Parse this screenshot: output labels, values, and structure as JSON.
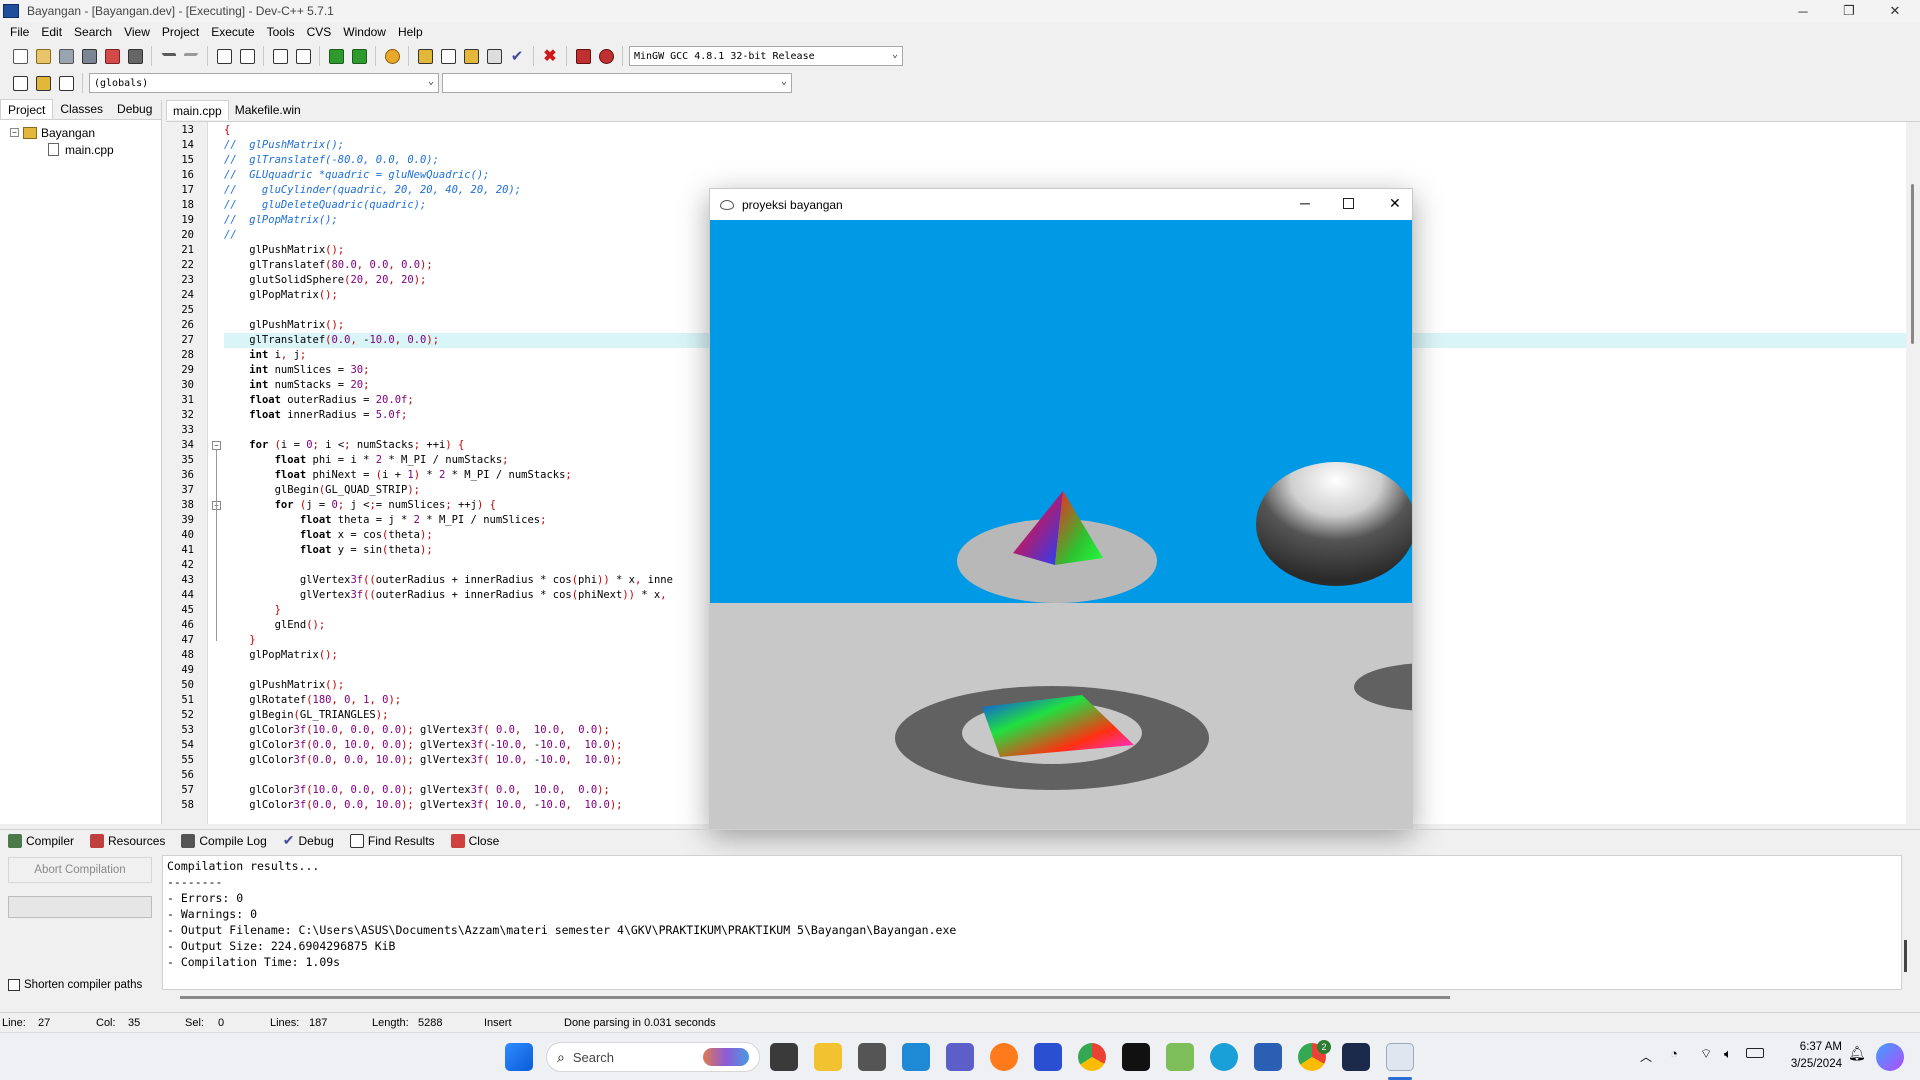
{
  "window": {
    "title": "Bayangan - [Bayangan.dev] - [Executing] - Dev-C++ 5.7.1",
    "minimize": "─",
    "restore": "❐",
    "close": "✕"
  },
  "menu": [
    "File",
    "Edit",
    "Search",
    "View",
    "Project",
    "Execute",
    "Tools",
    "CVS",
    "Window",
    "Help"
  ],
  "toolbar": {
    "compiler_select": "MinGW GCC 4.8.1 32-bit Release",
    "scope_select": "(globals)",
    "function_select": ""
  },
  "left_panel": {
    "tabs": [
      "Project",
      "Classes",
      "Debug"
    ],
    "active_tab": "Project",
    "tree": {
      "project": "Bayangan",
      "file": "main.cpp"
    }
  },
  "editor": {
    "tabs": [
      "main.cpp",
      "Makefile.win"
    ],
    "active_tab": "main.cpp",
    "highlighted_line": 27,
    "lines": [
      {
        "n": "13",
        "t": "{"
      },
      {
        "n": "14",
        "t": "//  glPushMatrix();"
      },
      {
        "n": "15",
        "t": "//  glTranslatef(-80.0, 0.0, 0.0);"
      },
      {
        "n": "16",
        "t": "//  GLUquadric *quadric = gluNewQuadric();"
      },
      {
        "n": "17",
        "t": "//    gluCylinder(quadric, 20, 20, 40, 20, 20);"
      },
      {
        "n": "18",
        "t": "//    gluDeleteQuadric(quadric);"
      },
      {
        "n": "19",
        "t": "//  glPopMatrix();"
      },
      {
        "n": "20",
        "t": "//"
      },
      {
        "n": "21",
        "t": "    glPushMatrix();"
      },
      {
        "n": "22",
        "t": "    glTranslatef(80.0, 0.0, 0.0);"
      },
      {
        "n": "23",
        "t": "    glutSolidSphere(20, 20, 20);"
      },
      {
        "n": "24",
        "t": "    glPopMatrix();"
      },
      {
        "n": "25",
        "t": ""
      },
      {
        "n": "26",
        "t": "    glPushMatrix();"
      },
      {
        "n": "27",
        "t": "    glTranslatef(0.0, -10.0, 0.0);"
      },
      {
        "n": "28",
        "t": "    int i, j;"
      },
      {
        "n": "29",
        "t": "    int numSlices = 30;"
      },
      {
        "n": "30",
        "t": "    int numStacks = 20;"
      },
      {
        "n": "31",
        "t": "    float outerRadius = 20.0f;"
      },
      {
        "n": "32",
        "t": "    float innerRadius = 5.0f;"
      },
      {
        "n": "33",
        "t": ""
      },
      {
        "n": "34",
        "t": "    for (i = 0; i < numStacks; ++i) {"
      },
      {
        "n": "35",
        "t": "        float phi = i * 2 * M_PI / numStacks;"
      },
      {
        "n": "36",
        "t": "        float phiNext = (i + 1) * 2 * M_PI / numStacks;"
      },
      {
        "n": "37",
        "t": "        glBegin(GL_QUAD_STRIP);"
      },
      {
        "n": "38",
        "t": "        for (j = 0; j <= numSlices; ++j) {"
      },
      {
        "n": "39",
        "t": "            float theta = j * 2 * M_PI / numSlices;"
      },
      {
        "n": "40",
        "t": "            float x = cos(theta);"
      },
      {
        "n": "41",
        "t": "            float y = sin(theta);"
      },
      {
        "n": "42",
        "t": ""
      },
      {
        "n": "43",
        "t": "            glVertex3f((outerRadius + innerRadius * cos(phi)) * x, inne"
      },
      {
        "n": "44",
        "t": "            glVertex3f((outerRadius + innerRadius * cos(phiNext)) * x,"
      },
      {
        "n": "45",
        "t": "        }"
      },
      {
        "n": "46",
        "t": "        glEnd();"
      },
      {
        "n": "47",
        "t": "    }"
      },
      {
        "n": "48",
        "t": "    glPopMatrix();"
      },
      {
        "n": "49",
        "t": ""
      },
      {
        "n": "50",
        "t": "    glPushMatrix();"
      },
      {
        "n": "51",
        "t": "    glRotatef(180, 0, 1, 0);"
      },
      {
        "n": "52",
        "t": "    glBegin(GL_TRIANGLES);"
      },
      {
        "n": "53",
        "t": "    glColor3f(10.0, 0.0, 0.0); glVertex3f( 0.0,  10.0,  0.0);"
      },
      {
        "n": "54",
        "t": "    glColor3f(0.0, 10.0, 0.0); glVertex3f(-10.0, -10.0,  10.0);"
      },
      {
        "n": "55",
        "t": "    glColor3f(0.0, 0.0, 10.0); glVertex3f( 10.0, -10.0,  10.0);"
      },
      {
        "n": "56",
        "t": ""
      },
      {
        "n": "57",
        "t": "    glColor3f(10.0, 0.0, 0.0); glVertex3f( 0.0,  10.0,  0.0);"
      },
      {
        "n": "58",
        "t": "    glColor3f(0.0, 0.0, 10.0); glVertex3f( 10.0, -10.0,  10.0);"
      }
    ]
  },
  "glut_window": {
    "title": "proyeksi bayangan",
    "sky_color": "#0099e6",
    "floor_color": "#c8c8c8",
    "shadow_color": "#616161"
  },
  "bottom_panel": {
    "tabs": [
      "Compiler",
      "Resources",
      "Compile Log",
      "Debug",
      "Find Results",
      "Close"
    ],
    "active_tab": "Compile Log",
    "abort_button": "Abort Compilation",
    "shorten_paths": "Shorten compiler paths",
    "output": [
      "Compilation results...",
      "--------",
      "- Errors: 0",
      "- Warnings: 0",
      "- Output Filename: C:\\Users\\ASUS\\Documents\\Azzam\\materi semester 4\\GKV\\PRAKTIKUM\\PRAKTIKUM 5\\Bayangan\\Bayangan.exe",
      "- Output Size: 224.6904296875 KiB",
      "- Compilation Time: 1.09s"
    ]
  },
  "status": {
    "line_label": "Line:",
    "line": "27",
    "col_label": "Col:",
    "col": "35",
    "sel_label": "Sel:",
    "sel": "0",
    "lines_label": "Lines:",
    "lines": "187",
    "length_label": "Length:",
    "length": "5288",
    "mode": "Insert",
    "message": "Done parsing in 0.031 seconds"
  },
  "taskbar": {
    "search_placeholder": "Search",
    "time": "6:37 AM",
    "date": "3/25/2024",
    "chrome_badge": "2"
  }
}
